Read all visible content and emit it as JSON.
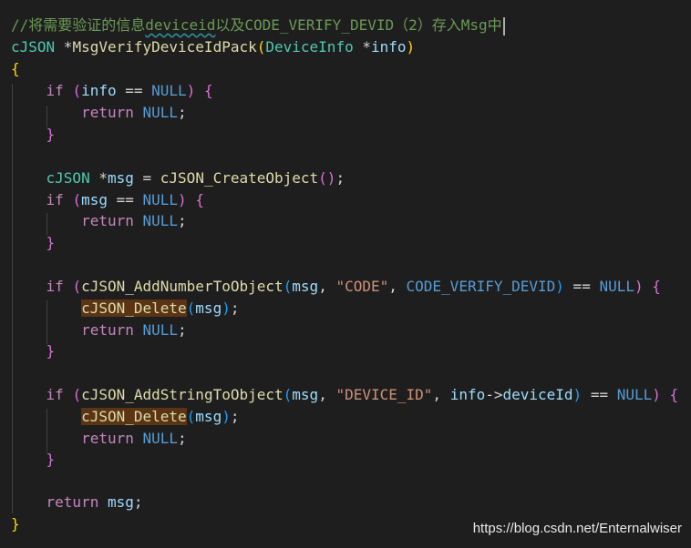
{
  "code": {
    "comment": "//将需要验证的信息",
    "comment_sq": "deviceid",
    "comment_rest": "以及CODE_VERIFY_DEVID（2）存入Msg中",
    "type_cjson": "cJSON",
    "ptr": " *",
    "fn_pack": "MsgVerifyDeviceIdPack",
    "type_devinfo": "DeviceInfo",
    "var_info": "info",
    "var_msg": "msg",
    "kw_if": "if",
    "kw_return": "return",
    "const_null": "NULL",
    "op_eq": " == ",
    "fn_create": "cJSON_CreateObject",
    "fn_addnum": "cJSON_AddNumberToObject",
    "fn_addstr": "cJSON_AddStringToObject",
    "fn_delete": "cJSON_Delete",
    "str_code": "\"CODE\"",
    "const_devid": "CODE_VERIFY_DEVID",
    "str_devid": "\"DEVICE_ID\"",
    "member_deviceid": "deviceId",
    "arrow": "->"
  },
  "watermark": "https://blog.csdn.net/Enternalwiser",
  "colors": {
    "background": "#1e1e1e",
    "comment": "#6a9955",
    "keyword": "#c586c0",
    "type": "#4ec9b0",
    "function": "#dcdcaa",
    "variable": "#9cdcfe",
    "constant": "#569cd6",
    "string": "#ce9178",
    "selection_highlight": "#5a3414"
  }
}
